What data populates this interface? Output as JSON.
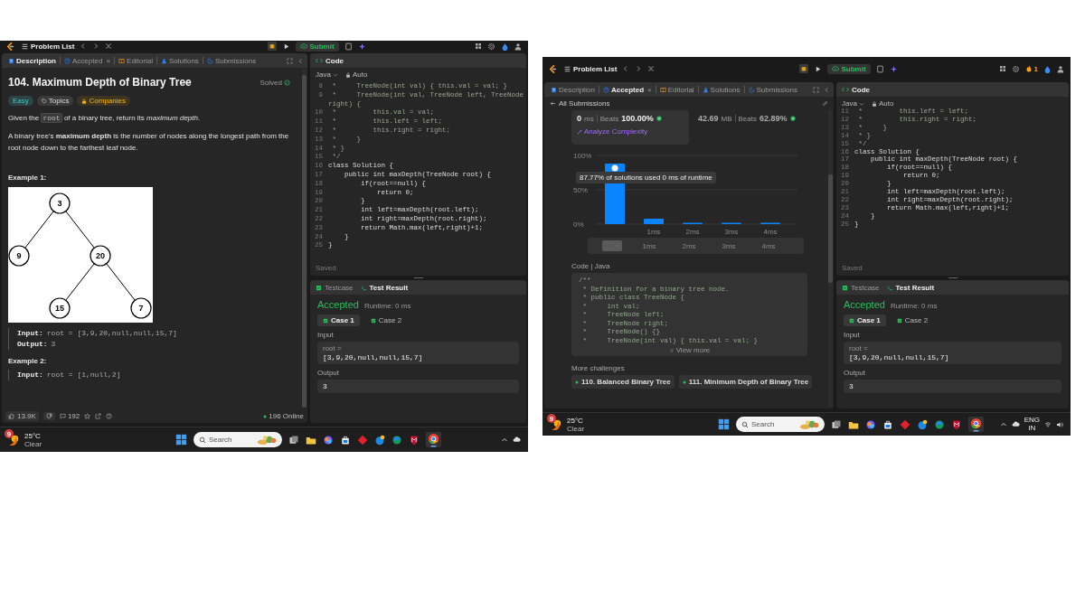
{
  "screenshots": [
    {
      "kind": "description",
      "topbar": {
        "problem_list": "Problem List",
        "submit": "Submit"
      },
      "tabs": [
        {
          "kind": "description",
          "label": "Description",
          "selected": true
        },
        {
          "kind": "accepted",
          "label": "Accepted",
          "close": "×",
          "selected": false
        },
        {
          "kind": "editorial",
          "label": "Editorial",
          "selected": false
        },
        {
          "kind": "solutions",
          "label": "Solutions",
          "selected": false
        },
        {
          "kind": "submissions",
          "label": "Submissions",
          "selected": false
        }
      ],
      "description": {
        "title": "104. Maximum Depth of Binary Tree",
        "status": "Solved",
        "tags": [
          {
            "kind": "difficulty",
            "label": "Easy"
          },
          {
            "kind": "topics",
            "label": "Topics"
          },
          {
            "kind": "companies",
            "label": "Companies"
          }
        ],
        "paragraphs": [
          [
            {
              "kind": "text",
              "text": "Given the "
            },
            {
              "kind": "code",
              "text": "root"
            },
            {
              "kind": "text",
              "text": " of a binary tree, return its *maximum depth*."
            }
          ],
          [
            {
              "kind": "text",
              "text": "A binary tree's **maximum depth** is the number of nodes along the longest path from the root node down to the farthest leaf node."
            }
          ]
        ],
        "examples": [
          {
            "heading": "Example 1:",
            "tree": {
              "label": "3",
              "children": [
                {
                  "label": "9"
                },
                {
                  "label": "20",
                  "children": [
                    {
                      "label": "15"
                    },
                    {
                      "label": "7"
                    }
                  ]
                }
              ]
            },
            "io": [
              {
                "label": "Input:",
                "value": "root = [3,9,20,null,null,15,7]"
              },
              {
                "label": "Output:",
                "value": "3"
              }
            ]
          },
          {
            "heading": "Example 2:",
            "io": [
              {
                "label": "Input:",
                "value": "root = [1,null,2]"
              }
            ]
          }
        ],
        "footer": {
          "likes": "13.9K",
          "comments": "192",
          "online": "196 Online"
        }
      },
      "editor": {
        "title": "Code",
        "language": "Java",
        "mode": "Auto",
        "saved": "Saved",
        "lines": [
          {
            "n": "8",
            "kind": "comment",
            "text": " *     TreeNode(int val) { this.val = val; }"
          },
          {
            "n": "9",
            "kind": "comment",
            "text": " *     TreeNode(int val, TreeNode left, TreeNode right) {"
          },
          {
            "n": "10",
            "kind": "comment",
            "text": " *         this.val = val;"
          },
          {
            "n": "11",
            "kind": "comment",
            "text": " *         this.left = left;"
          },
          {
            "n": "12",
            "kind": "comment",
            "text": " *         this.right = right;"
          },
          {
            "n": "13",
            "kind": "comment",
            "text": " *     }"
          },
          {
            "n": "14",
            "kind": "comment",
            "text": " * }"
          },
          {
            "n": "15",
            "kind": "comment",
            "text": " */"
          },
          {
            "n": "16",
            "kind": "code",
            "text": "class Solution {"
          },
          {
            "n": "17",
            "kind": "code",
            "text": "    public int maxDepth(TreeNode root) {"
          },
          {
            "n": "18",
            "kind": "code",
            "text": "        if(root==null) {"
          },
          {
            "n": "19",
            "kind": "code",
            "text": "            return 0;"
          },
          {
            "n": "20",
            "kind": "code",
            "text": "        }"
          },
          {
            "n": "21",
            "kind": "code",
            "text": "        int left=maxDepth(root.left);"
          },
          {
            "n": "22",
            "kind": "code",
            "text": "        int right=maxDepth(root.right);"
          },
          {
            "n": "23",
            "kind": "code",
            "text": "        return Math.max(left,right)+1;"
          },
          {
            "n": "24",
            "kind": "code",
            "text": "    }"
          },
          {
            "n": "25",
            "kind": "code",
            "text": "}"
          }
        ]
      },
      "test_result": {
        "tabs": [
          {
            "kind": "testcase",
            "label": "Testcase",
            "selected": false
          },
          {
            "kind": "result",
            "label": "Test Result",
            "selected": true
          }
        ],
        "status": "Accepted",
        "runtime": "Runtime: 0 ms",
        "cases": [
          {
            "label": "Case 1",
            "selected": true
          },
          {
            "label": "Case 2",
            "selected": false
          }
        ],
        "input_label": "Input",
        "param": "root =",
        "input": "[3,9,20,null,null,15,7]",
        "output_label": "Output",
        "output": "3"
      },
      "taskbar": {
        "badge": "9",
        "temperature": "25°C",
        "condition": "Clear",
        "search_placeholder": "Search"
      }
    },
    {
      "kind": "submission",
      "topbar": {
        "problem_list": "Problem List",
        "submit": "Submit",
        "streak": "1"
      },
      "tabs": [
        {
          "kind": "description",
          "label": "Description",
          "selected": false
        },
        {
          "kind": "accepted",
          "label": "Accepted",
          "close": "×",
          "selected": true
        },
        {
          "kind": "editorial",
          "label": "Editorial",
          "selected": false
        },
        {
          "kind": "solutions",
          "label": "Solutions",
          "selected": false
        },
        {
          "kind": "submissions",
          "label": "Submissions",
          "selected": false
        }
      ],
      "submission": {
        "back": "All Submissions",
        "runtime": {
          "value": "0",
          "unit": "ms",
          "beats_label": "Beats",
          "beats": "100.00%"
        },
        "analyze": "Analyze Complexity",
        "memory": {
          "value": "42.69",
          "unit": "MB",
          "beats_label": "Beats",
          "beats": "62.89%"
        },
        "chart_data": {
          "type": "bar",
          "categories": [
            null,
            "1ms",
            "2ms",
            "3ms",
            "4ms"
          ],
          "values": [
            88,
            8,
            2,
            2,
            2
          ],
          "ylim": [
            0,
            100
          ],
          "yticks": [
            {
              "value": 0,
              "label": "0%"
            },
            {
              "value": 50,
              "label": "50%"
            },
            {
              "value": 100,
              "label": "100%"
            }
          ],
          "annotations": [
            "87.77% of solutions used 0 ms of runtime"
          ]
        },
        "navigator_labels": [
          "1ms",
          "2ms",
          "3ms",
          "4ms"
        ],
        "code_label": "Code | Java",
        "code_lines": [
          "/**",
          " * Definition for a binary tree node.",
          " * public class TreeNode {",
          " *     int val;",
          " *     TreeNode left;",
          " *     TreeNode right;",
          " *     TreeNode() {}",
          " *     TreeNode(int val) { this.val = val; }"
        ],
        "view_more": "View more",
        "more_label": "More challenges",
        "challenges": [
          "110. Balanced Binary Tree",
          "111. Minimum Depth of Binary Tree"
        ]
      },
      "editor": {
        "title": "Code",
        "language": "Java",
        "mode": "Auto",
        "saved": "Saved",
        "lines": [
          {
            "n": "11",
            "kind": "comment",
            "text": " *         this.left = left;"
          },
          {
            "n": "12",
            "kind": "comment",
            "text": " *         this.right = right;"
          },
          {
            "n": "13",
            "kind": "comment",
            "text": " *     }"
          },
          {
            "n": "14",
            "kind": "comment",
            "text": " * }"
          },
          {
            "n": "15",
            "kind": "comment",
            "text": " */"
          },
          {
            "n": "16",
            "kind": "code",
            "text": "class Solution {"
          },
          {
            "n": "17",
            "kind": "code",
            "text": "    public int maxDepth(TreeNode root) {"
          },
          {
            "n": "18",
            "kind": "code",
            "text": "        if(root==null) {"
          },
          {
            "n": "19",
            "kind": "code",
            "text": "            return 0;"
          },
          {
            "n": "20",
            "kind": "code",
            "text": "        }"
          },
          {
            "n": "21",
            "kind": "code",
            "text": "        int left=maxDepth(root.left);"
          },
          {
            "n": "22",
            "kind": "code",
            "text": "        int right=maxDepth(root.right);"
          },
          {
            "n": "23",
            "kind": "code",
            "text": "        return Math.max(left,right)+1;"
          },
          {
            "n": "24",
            "kind": "code",
            "text": "    }"
          },
          {
            "n": "25",
            "kind": "code",
            "text": "}"
          }
        ]
      },
      "test_result": {
        "tabs": [
          {
            "kind": "testcase",
            "label": "Testcase",
            "selected": false
          },
          {
            "kind": "result",
            "label": "Test Result",
            "selected": true
          }
        ],
        "status": "Accepted",
        "runtime": "Runtime: 0 ms",
        "cases": [
          {
            "label": "Case 1",
            "selected": true
          },
          {
            "label": "Case 2",
            "selected": false
          }
        ],
        "input_label": "Input",
        "param": "root =",
        "input": "[3,9,20,null,null,15,7]",
        "output_label": "Output",
        "output": "3"
      },
      "taskbar": {
        "badge": "9",
        "temperature": "25°C",
        "condition": "Clear",
        "search_placeholder": "Search",
        "language": "ENG",
        "region": "IN"
      }
    }
  ]
}
